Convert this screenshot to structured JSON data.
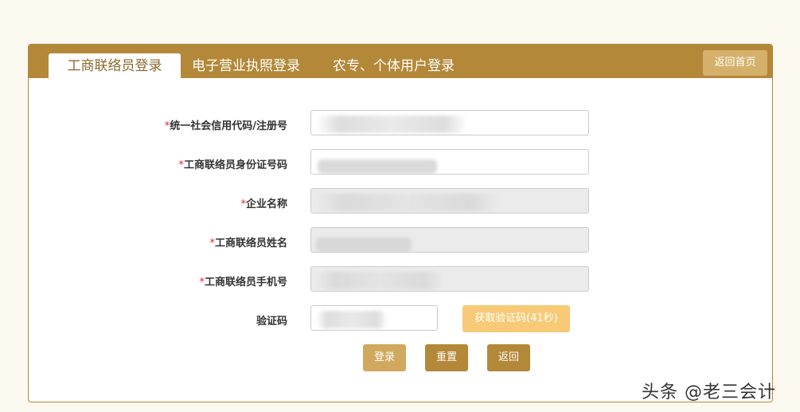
{
  "tabs": [
    {
      "label": "工商联络员登录",
      "active": true
    },
    {
      "label": "电子营业执照登录",
      "active": false
    },
    {
      "label": "农专、个体用户登录",
      "active": false
    }
  ],
  "header": {
    "home_button": "返回首页"
  },
  "form": {
    "required_mark": "*",
    "fields": [
      {
        "label": "统一社会信用代码/注册号",
        "required": true,
        "readonly": false
      },
      {
        "label": "工商联络员身份证号码",
        "required": true,
        "readonly": false
      },
      {
        "label": "企业名称",
        "required": true,
        "readonly": true
      },
      {
        "label": "工商联络员姓名",
        "required": true,
        "readonly": true
      },
      {
        "label": "工商联络员手机号",
        "required": true,
        "readonly": true
      },
      {
        "label": "验证码",
        "required": false,
        "readonly": false
      }
    ],
    "get_code_button": "获取验证码(41秒)"
  },
  "actions": {
    "login": "登录",
    "reset": "重置",
    "back": "返回"
  },
  "watermark": "头条 @老三会计",
  "colors": {
    "brand": "#b38838",
    "code_button": "#f8c976",
    "required": "#e02b2b"
  }
}
